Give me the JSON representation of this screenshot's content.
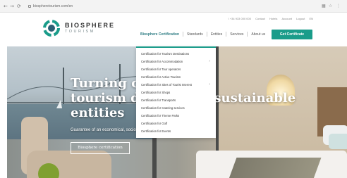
{
  "browser": {
    "back_icon": "arrow-left-icon",
    "forward_icon": "arrow-right-icon",
    "reload_icon": "reload-icon",
    "url": "biospheretourism.com/en"
  },
  "brand": {
    "name": "BIOSPHERE",
    "sub": "TOURISM",
    "accent": "#1a9c8a"
  },
  "topbar": [
    "\\ +34 933 000 000",
    "Contact",
    "Hotels",
    "Account",
    "Logout",
    "EN"
  ],
  "nav": {
    "items": [
      "Biosphere Certification",
      "Standards",
      "Entities",
      "Services",
      "About us"
    ],
    "cta": "Get Certificate"
  },
  "dropdown": {
    "items": [
      {
        "label": "Certification for Tourism Destinations",
        "has_sub": false
      },
      {
        "label": "Certification for Accommodation",
        "has_sub": true
      },
      {
        "label": "Certification for Tour operators",
        "has_sub": false
      },
      {
        "label": "Certification for Active Tourism",
        "has_sub": false
      },
      {
        "label": "Certification for Sites of Tourist Interest",
        "has_sub": true
      },
      {
        "label": "Certification for Shops",
        "has_sub": false
      },
      {
        "label": "Certification for Transports",
        "has_sub": false
      },
      {
        "label": "Certification for Catering services",
        "has_sub": false
      },
      {
        "label": "Certification for Theme Parks",
        "has_sub": false
      },
      {
        "label": "Certification for Golf",
        "has_sub": false
      },
      {
        "label": "Certification for Events",
        "has_sub": false
      }
    ],
    "arrow": "›"
  },
  "hero": {
    "title_line1": "Turning com",
    "title_line2_a": "tourism des",
    "title_line2_b": "sustainable",
    "title_line3": "entities",
    "subtitle": "Guarantee of an economical, sociocultural and environmental balance",
    "button": "Biosphere certification"
  }
}
